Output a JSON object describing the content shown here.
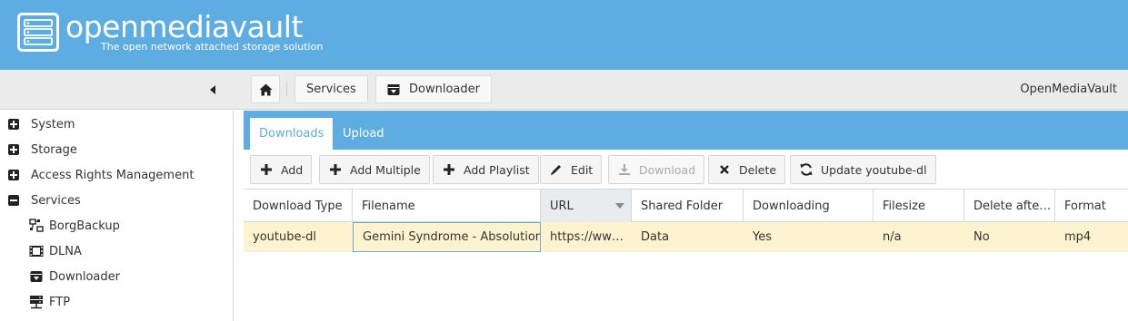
{
  "header": {
    "title": "openmediavault",
    "subtitle": "The open network attached storage solution"
  },
  "breadcrumb": {
    "home_icon": "home-icon",
    "items": [
      "Services",
      "Downloader"
    ]
  },
  "hostname": "OpenMediaVault",
  "sidebar": {
    "items": [
      {
        "label": "System",
        "state": "collapsed"
      },
      {
        "label": "Storage",
        "state": "collapsed"
      },
      {
        "label": "Access Rights Management",
        "state": "collapsed"
      },
      {
        "label": "Services",
        "state": "expanded"
      }
    ],
    "subitems": [
      {
        "label": "BorgBackup",
        "icon": "borgbackup-icon"
      },
      {
        "label": "DLNA",
        "icon": "film-icon"
      },
      {
        "label": "Downloader",
        "icon": "download-box-icon"
      },
      {
        "label": "FTP",
        "icon": "server-icon"
      }
    ]
  },
  "tabs": [
    {
      "label": "Downloads",
      "active": true
    },
    {
      "label": "Upload",
      "active": false
    }
  ],
  "toolbar": {
    "add": "Add",
    "add_multiple": "Add Multiple",
    "add_playlist": "Add Playlist",
    "edit": "Edit",
    "download": "Download",
    "delete": "Delete",
    "update": "Update youtube-dl"
  },
  "table": {
    "columns": [
      "Download Type",
      "Filename",
      "URL",
      "Shared Folder",
      "Downloading",
      "Filesize",
      "Delete afte…",
      "Format"
    ],
    "sorted_column": "URL",
    "rows": [
      [
        "youtube-dl",
        "Gemini Syndrome - Absolution",
        "https://ww…",
        "Data",
        "Yes",
        "n/a",
        "No",
        "mp4"
      ]
    ]
  },
  "colors": {
    "brand": "#5dade2",
    "selected_row": "#fdf3cf"
  }
}
